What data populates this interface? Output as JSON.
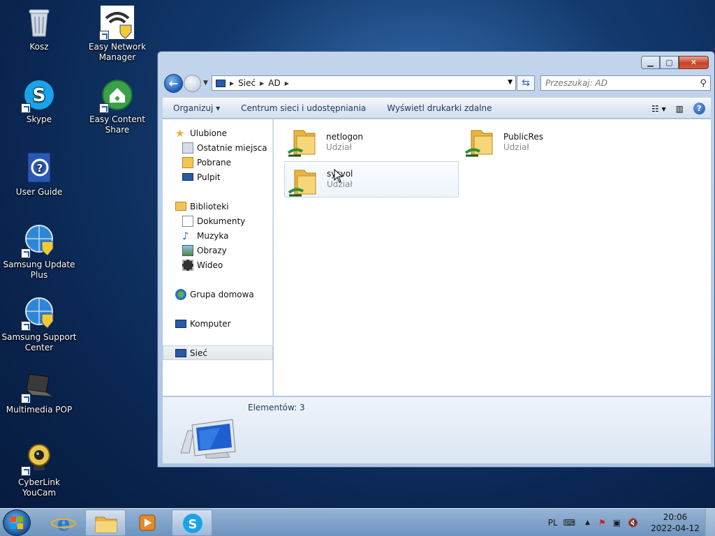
{
  "desktop": {
    "icons": [
      {
        "label": "Kosz",
        "icon": "recycle-bin-icon"
      },
      {
        "label": "Easy Network Manager",
        "icon": "wifi-shield-icon"
      },
      {
        "label": "Skype",
        "icon": "skype-icon"
      },
      {
        "label": "Easy Content Share",
        "icon": "home-share-icon"
      },
      {
        "label": "User Guide",
        "icon": "help-book-icon"
      },
      {
        "label": "Samsung Update Plus",
        "icon": "globe-shield-icon"
      },
      {
        "label": "Samsung Support Center",
        "icon": "globe-shield-icon"
      },
      {
        "label": "Multimedia POP",
        "icon": "laptop-icon"
      },
      {
        "label": "CyberLink YouCam",
        "icon": "webcam-icon"
      }
    ]
  },
  "window": {
    "address": {
      "seg1": "Sieć",
      "seg2": "AD"
    },
    "search_placeholder": "Przeszukaj: AD",
    "toolbar": {
      "organize": "Organizuj",
      "network_center": "Centrum sieci i udostępniania",
      "remote_printers": "Wyświetl drukarki zdalne"
    },
    "navpane": {
      "favorites": "Ulubione",
      "recent": "Ostatnie miejsca",
      "downloads": "Pobrane",
      "desktop": "Pulpit",
      "libraries": "Biblioteki",
      "documents": "Dokumenty",
      "music": "Muzyka",
      "pictures": "Obrazy",
      "videos": "Wideo",
      "homegroup": "Grupa domowa",
      "computer": "Komputer",
      "network": "Sieć"
    },
    "items": [
      {
        "name": "netlogon",
        "type": "Udział"
      },
      {
        "name": "PublicRes",
        "type": "Udział"
      },
      {
        "name": "sysvol",
        "type": "Udział"
      }
    ],
    "details": {
      "count": "Elementów: 3"
    }
  },
  "taskbar": {
    "language": "PL",
    "time": "20:06",
    "date": "2022-04-12"
  },
  "colors": {
    "accent": "#1d5cb3",
    "close": "#c7432c",
    "folder": "#f2c453"
  }
}
